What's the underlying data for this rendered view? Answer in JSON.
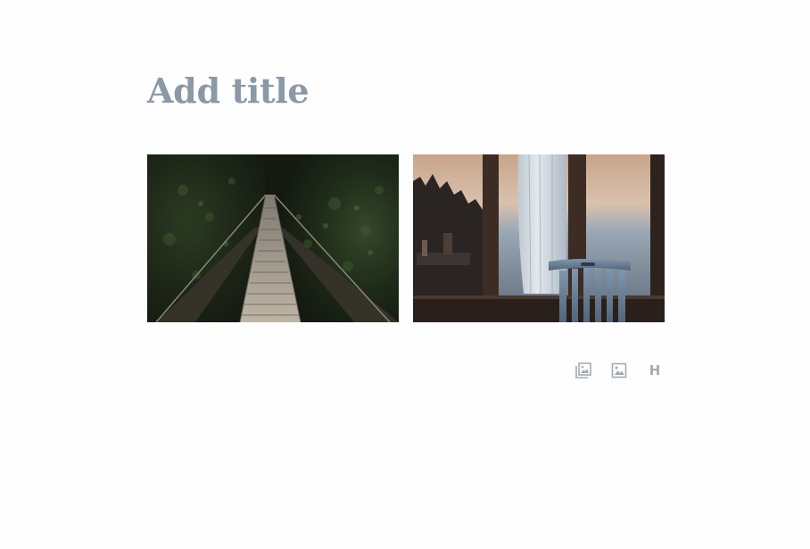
{
  "post": {
    "title_placeholder": "Add title"
  },
  "gallery": {
    "images": [
      {
        "subject": "suspension-bridge-forest"
      },
      {
        "subject": "window-chair-curtain"
      }
    ]
  },
  "block_inserter": {
    "buttons": [
      {
        "icon": "gallery-icon"
      },
      {
        "icon": "image-icon"
      },
      {
        "icon": "heading-icon",
        "glyph": "H"
      }
    ]
  },
  "colors": {
    "background": "#fefefe",
    "title_placeholder": "#8b98a6",
    "inserter_icons": "#a3abb3"
  }
}
